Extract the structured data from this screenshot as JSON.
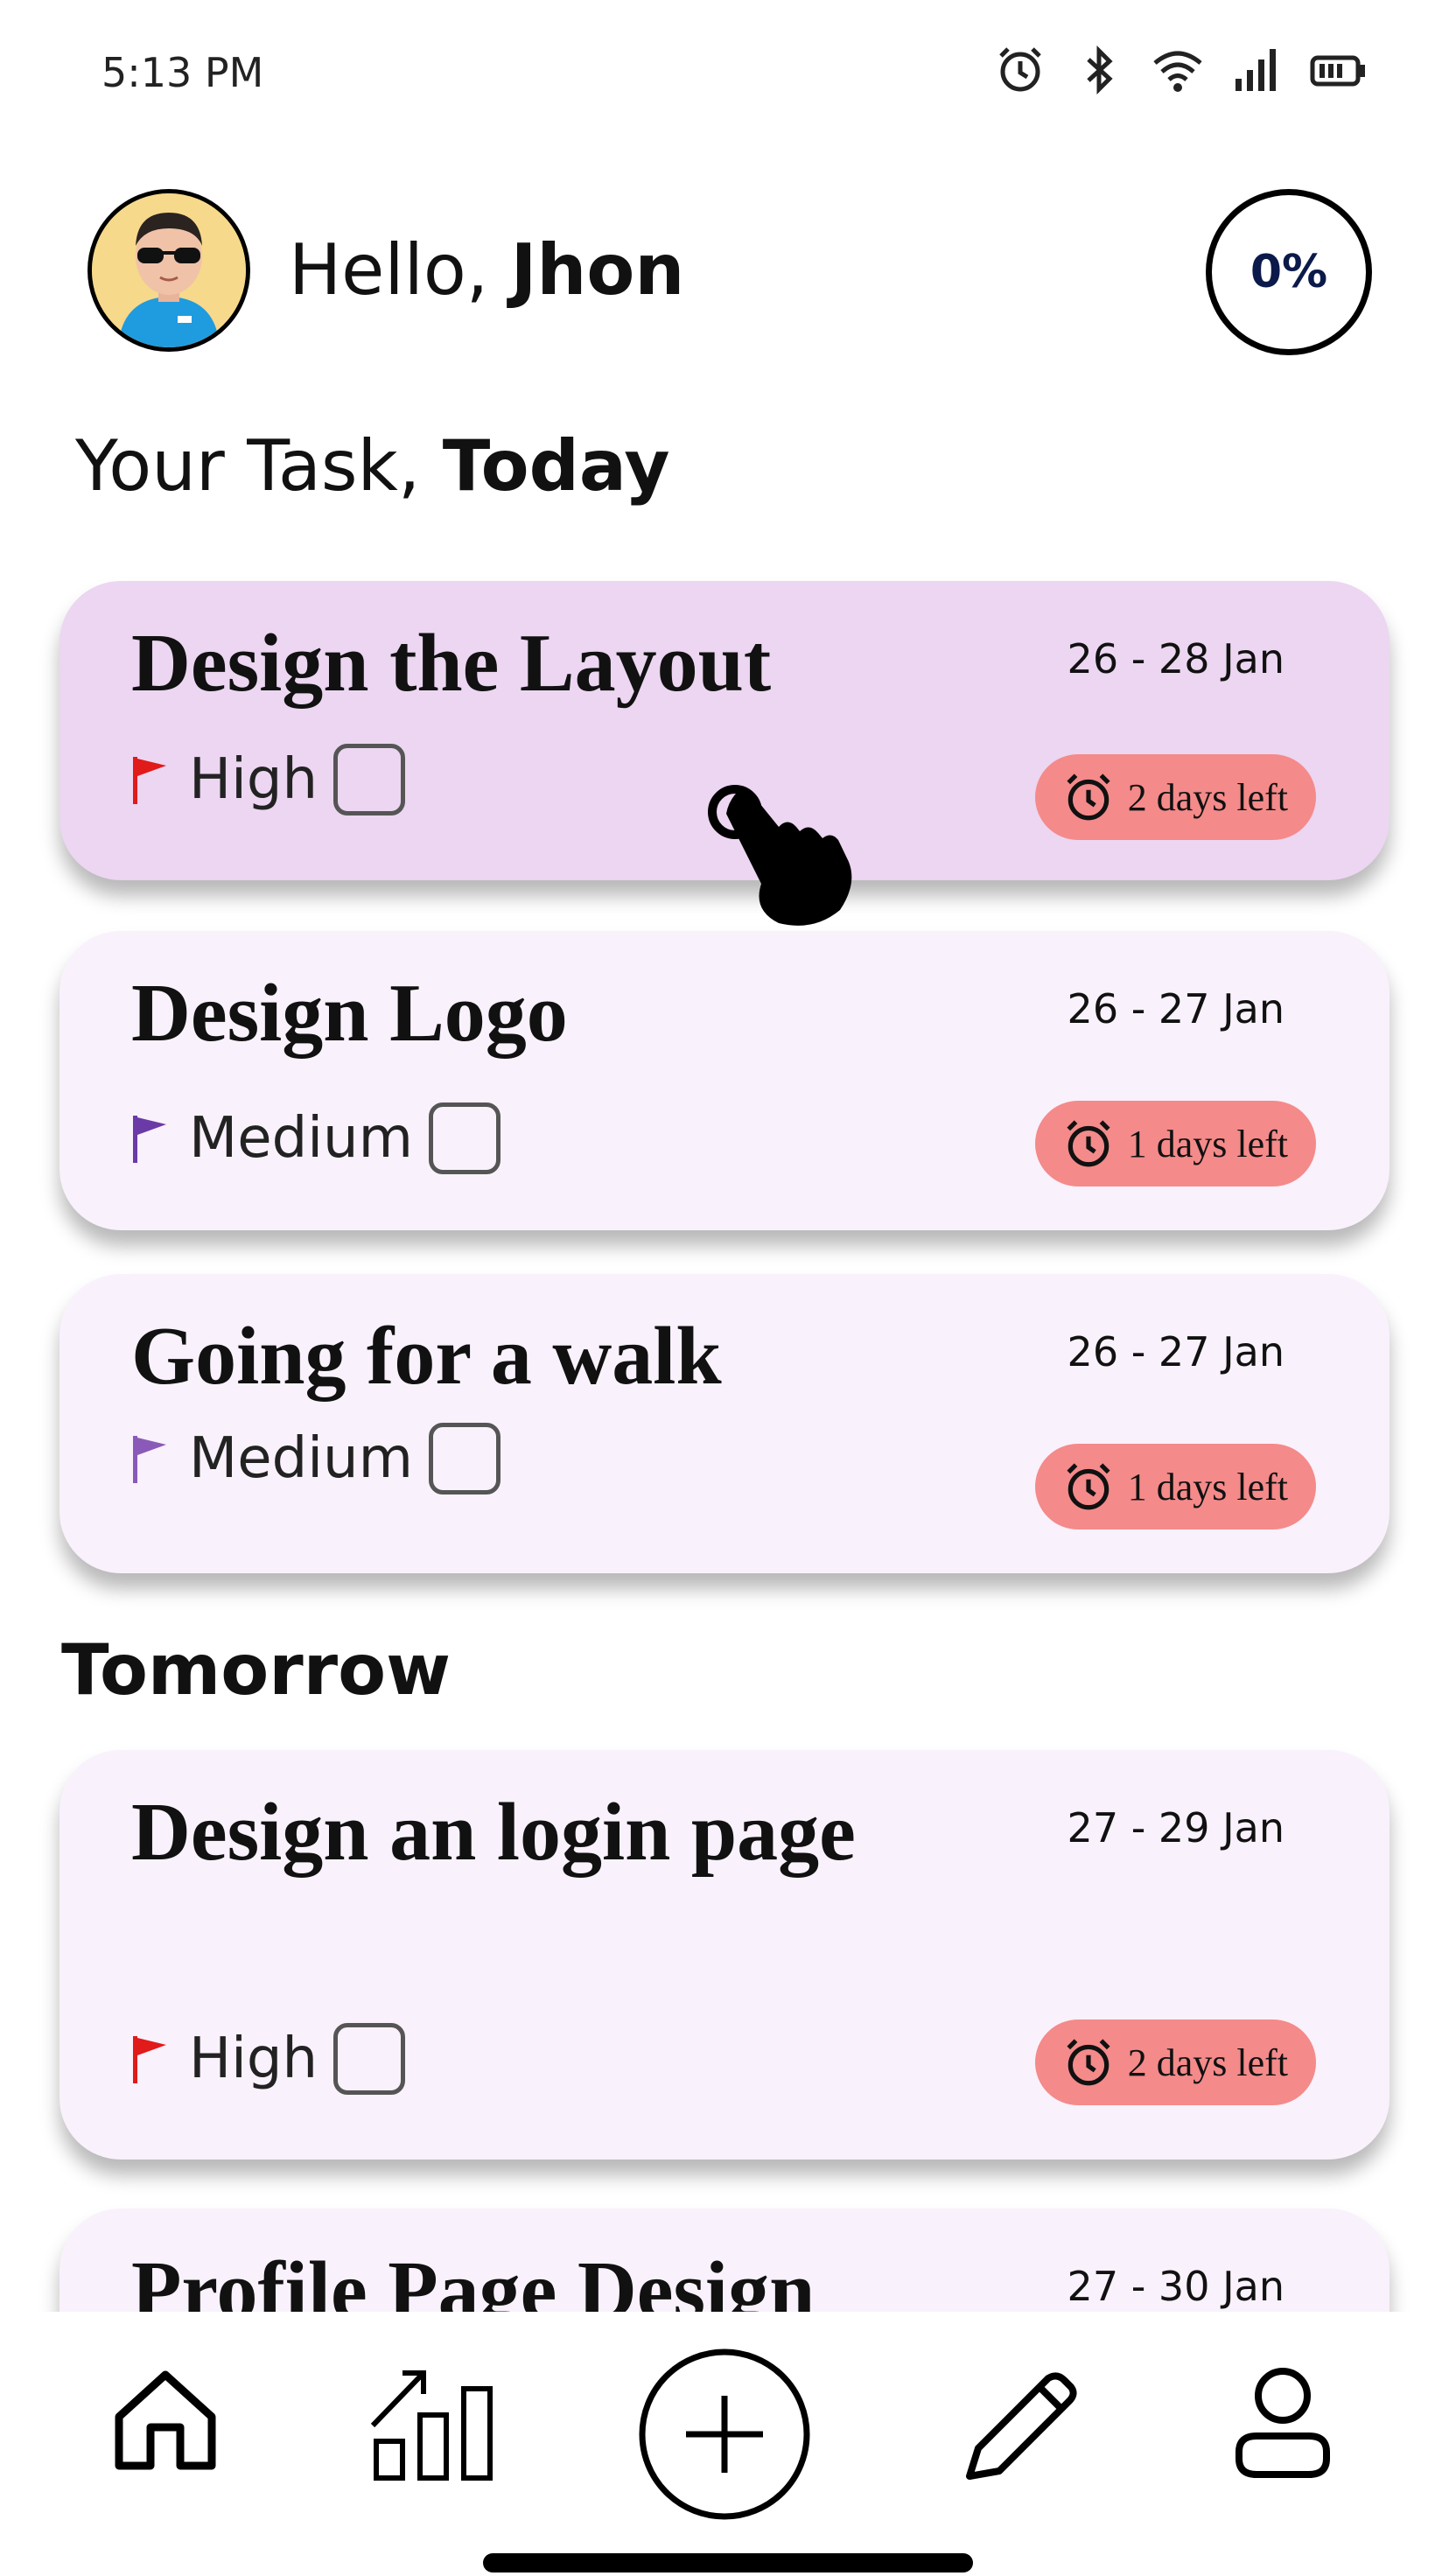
{
  "status_bar": {
    "time": "5:13 PM"
  },
  "header": {
    "greeting": "Hello,",
    "name": "Jhon",
    "progress": "0%"
  },
  "section_today": {
    "prefix": "Your Task,",
    "label": "Today"
  },
  "today_tasks": [
    {
      "title": "Design the Layout",
      "date": "26 - 28 Jan",
      "priority": "High",
      "priority_color": "#e11a1a",
      "badge": "2 days left",
      "active": true
    },
    {
      "title": "Design Logo",
      "date": "26 - 27 Jan",
      "priority": "Medium",
      "priority_color": "#6a3aa6",
      "badge": "1 days left",
      "active": false
    },
    {
      "title": "Going for a walk",
      "date": "26 - 27 Jan",
      "priority": "Medium",
      "priority_color": "#8a5ab8",
      "badge": "1 days left",
      "active": false
    }
  ],
  "section_tomorrow": {
    "label": "Tomorrow"
  },
  "tomorrow_tasks": [
    {
      "title": "Design an login page",
      "date": "27 - 29 Jan",
      "priority": "High",
      "priority_color": "#e11a1a",
      "badge": "2 days left"
    },
    {
      "title": "Profile Page Design",
      "date": "27 - 30 Jan"
    }
  ],
  "colors": {
    "card_active": "#ecd6f1",
    "card": "#f9f1fb",
    "badge": "#f48a8a"
  },
  "nav": {
    "icons": [
      "home-icon",
      "stats-icon",
      "add-icon",
      "edit-icon",
      "profile-icon"
    ]
  }
}
